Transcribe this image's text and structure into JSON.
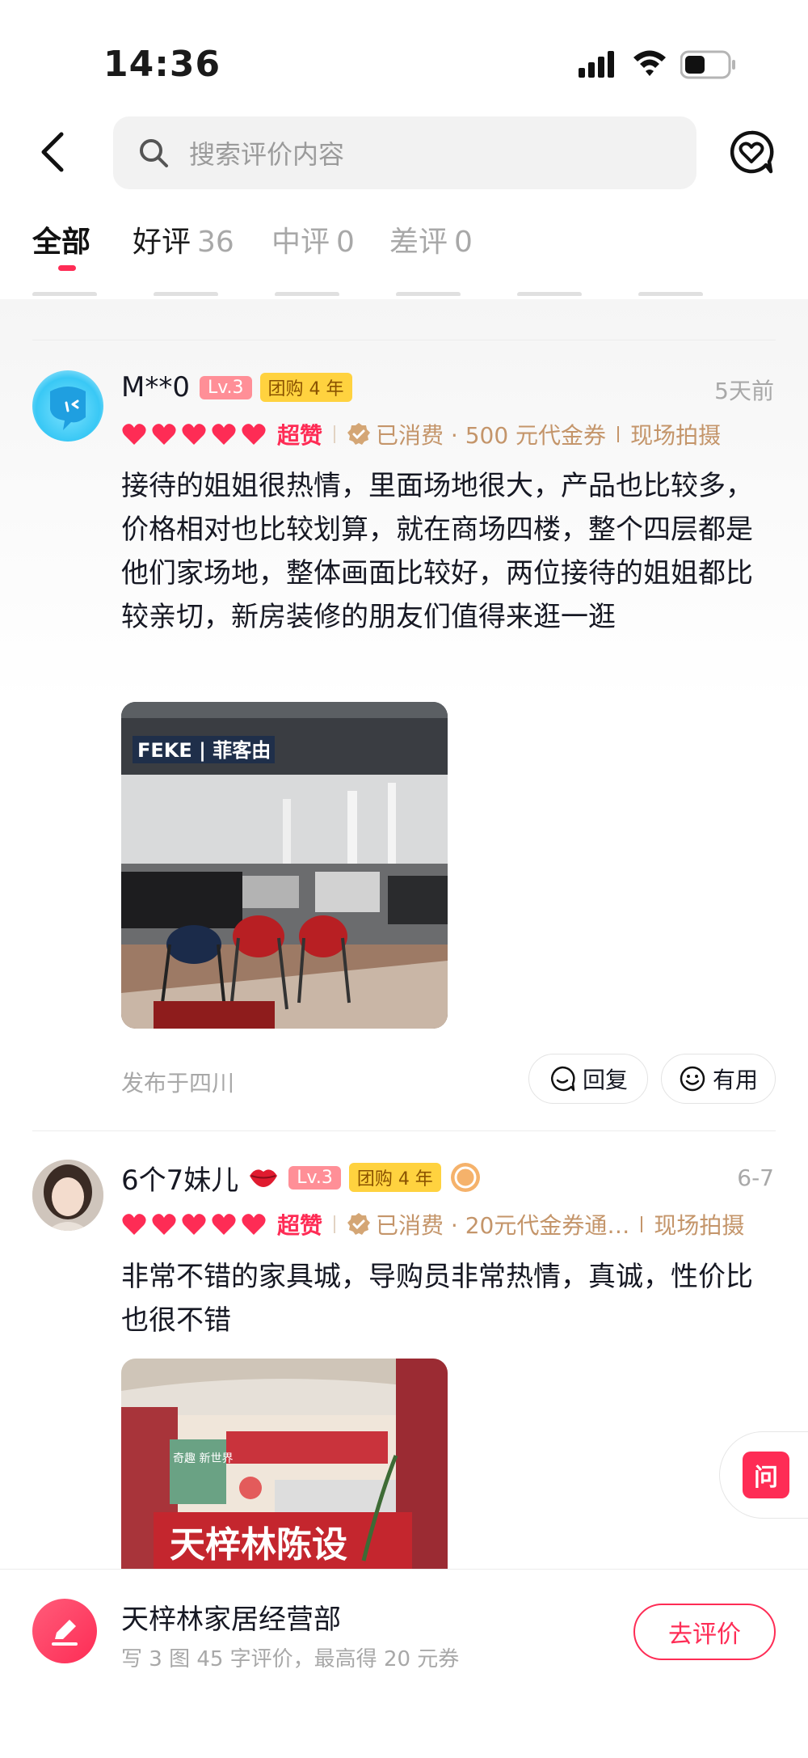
{
  "status_bar": {
    "time": "14:36"
  },
  "search": {
    "placeholder": "搜索评价内容"
  },
  "tabs": [
    {
      "label": "全部",
      "count": ""
    },
    {
      "label": "好评",
      "count": "36"
    },
    {
      "label": "中评",
      "count": "0"
    },
    {
      "label": "差评",
      "count": "0"
    }
  ],
  "reviews": [
    {
      "user": "M**0",
      "level": "Lv.3",
      "group_badge": "团购 4 年",
      "date": "5天前",
      "hearts": 5,
      "rating_word": "超赞",
      "consume": "已消费 · 500 元代金券",
      "tag": "现场拍摄",
      "text": "接待的姐姐很热情，里面场地很大，产品也比较多，价格相对也比较划算，就在商场四楼，整个四层都是他们家场地，整体画面比较好，两位接待的姐姐都比较亲切，新房装修的朋友们值得来逛一逛",
      "photo_sign": "FEKE | 菲客由",
      "location": "发布于四川",
      "reply_label": "回复",
      "useful_label": "有用"
    },
    {
      "user": "6个7妹儿",
      "level": "Lv.3",
      "group_badge": "团购 4 年",
      "date": "6-7",
      "hearts": 5,
      "rating_word": "超赞",
      "consume": "已消费 · 20元代金券通…",
      "tag": "现场拍摄",
      "text": "非常不错的家具城，导购员非常热情，真诚，性价比也很不错",
      "photo_sign": "天梓林陈设",
      "photo_sign_small": "奇趣 新世界"
    }
  ],
  "ask_label": "问",
  "bottom": {
    "title": "天梓林家居经营部",
    "subtitle": "写 3 图 45 字评价，最高得 20 元券",
    "button": "去评价"
  },
  "colors": {
    "accent": "#fe2c55",
    "gold": "#c4956a",
    "badge_yellow": "#ffd23f"
  }
}
